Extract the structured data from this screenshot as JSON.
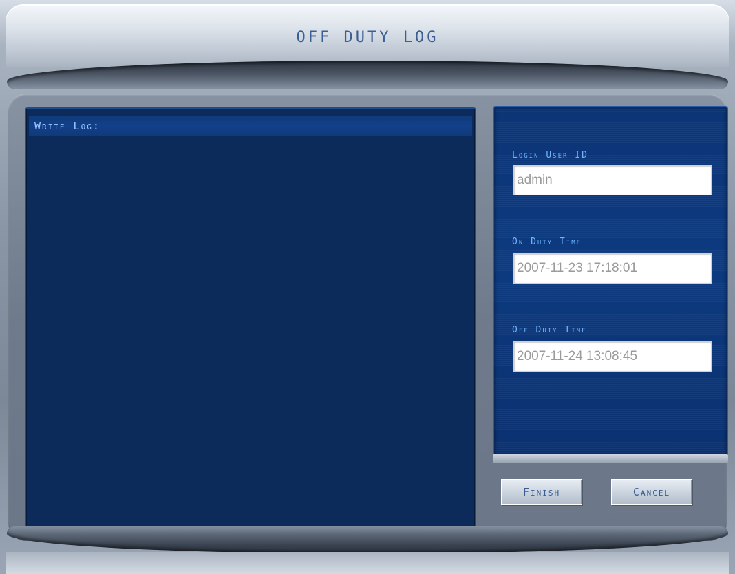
{
  "window": {
    "title": "OFF DUTY LOG"
  },
  "log": {
    "label": "Write Log:",
    "value": ""
  },
  "info": {
    "login_user_label": "Login User ID",
    "login_user_value": "admin",
    "on_duty_label": "On Duty Time",
    "on_duty_value": "2007-11-23 17:18:01",
    "off_duty_label": "Off Duty Time",
    "off_duty_value": "2007-11-24 13:08:45"
  },
  "buttons": {
    "finish_label": "Finish",
    "cancel_label": "Cancel"
  },
  "colors": {
    "panel_blue": "#0c2b5a",
    "label_blue": "#6fb4ff",
    "title_blue": "#3c5f93"
  }
}
